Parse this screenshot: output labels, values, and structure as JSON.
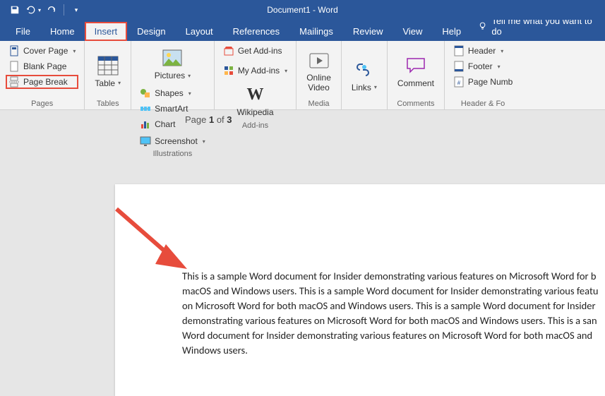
{
  "title": "Document1  -  Word",
  "tabs": {
    "file": "File",
    "home": "Home",
    "insert": "Insert",
    "design": "Design",
    "layout": "Layout",
    "references": "References",
    "mailings": "Mailings",
    "review": "Review",
    "view": "View",
    "help": "Help",
    "tellme": "Tell me what you want to do"
  },
  "pages_group": {
    "cover_page": "Cover Page",
    "blank_page": "Blank Page",
    "page_break": "Page Break",
    "label": "Pages"
  },
  "tables_group": {
    "table": "Table",
    "label": "Tables"
  },
  "illustrations_group": {
    "pictures": "Pictures",
    "shapes": "Shapes",
    "smartart": "SmartArt",
    "chart": "Chart",
    "screenshot": "Screenshot",
    "label": "Illustrations"
  },
  "addins_group": {
    "get_addins": "Get Add-ins",
    "my_addins": "My Add-ins",
    "wikipedia": "Wikipedia",
    "label": "Add-ins"
  },
  "media_group": {
    "online_video": "Online\nVideo",
    "label": "Media"
  },
  "links_group": {
    "links": "Links",
    "label": ""
  },
  "comments_group": {
    "comment": "Comment",
    "label": "Comments"
  },
  "headerfooter_group": {
    "header": "Header",
    "footer": "Footer",
    "page_number": "Page Numb",
    "label": "Header & Fo"
  },
  "page_indicator": {
    "prefix": "Page ",
    "current": "1",
    "of": " of ",
    "total": "3"
  },
  "body_text": "This is a sample Word document for Insider demonstrating various features on Microsoft Word for b macOS and Windows users. This is a sample Word document for Insider demonstrating various featu on Microsoft Word for both macOS and Windows users. This is a sample Word document for Insider demonstrating various features on Microsoft Word for both macOS and Windows users. This is a san Word document for Insider demonstrating various features on Microsoft Word for both macOS and Windows users."
}
